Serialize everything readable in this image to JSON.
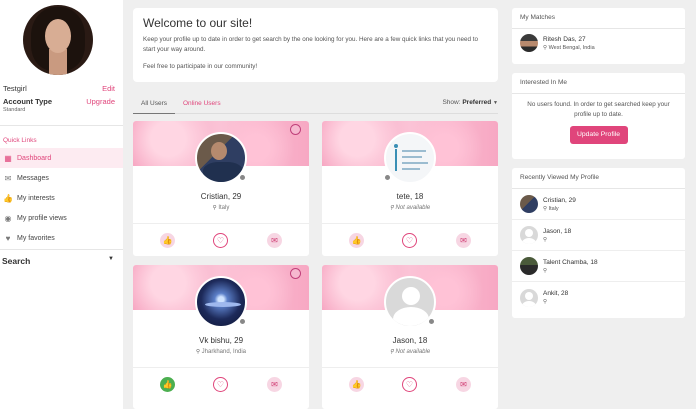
{
  "user": {
    "name": "Testgirl",
    "edit_label": "Edit",
    "account_type_label": "Account Type",
    "upgrade_label": "Upgrade",
    "account_level": "Standard"
  },
  "quick_links": {
    "title": "Quick Links",
    "items": [
      {
        "label": "Dashboard",
        "icon": "dashboard-icon",
        "active": true
      },
      {
        "label": "Messages",
        "icon": "envelope-icon"
      },
      {
        "label": "My interests",
        "icon": "thumbs-up-icon"
      },
      {
        "label": "My profile views",
        "icon": "eye-icon"
      },
      {
        "label": "My favorites",
        "icon": "heart-icon"
      }
    ]
  },
  "search": {
    "label": "Search"
  },
  "welcome": {
    "title": "Welcome to our site!",
    "text1": "Keep your profile up to date in order to get search by the one looking for you. Here are a few quick links that you need to start your way around.",
    "text2": "Feel free to participate in our community!"
  },
  "tabs": {
    "all": "All Users",
    "online": "Online Users",
    "show_label": "Show:",
    "show_value": "Preferred"
  },
  "cards": [
    {
      "name": "Cristian, 29",
      "location": "Italy"
    },
    {
      "name": "tete, 18",
      "location": "Not available"
    },
    {
      "name": "Vk bishu, 29",
      "location": "Jharkhand, India"
    },
    {
      "name": "Jason, 18",
      "location": "Not available"
    }
  ],
  "my_matches": {
    "title": "My Matches",
    "items": [
      {
        "name": "Ritesh Das, 27",
        "location": "West Bengal, India"
      }
    ]
  },
  "interested": {
    "title": "Interested In Me",
    "empty_text": "No users found. In order to get searched keep your profile up to date.",
    "button": "Update Profile"
  },
  "recently_viewed": {
    "title": "Recently Viewed My Profile",
    "items": [
      {
        "name": "Cristian, 29",
        "location": "Italy"
      },
      {
        "name": "Jason, 18",
        "location": ""
      },
      {
        "name": "Talent Chamba, 18",
        "location": ""
      },
      {
        "name": "Ankit, 28",
        "location": ""
      }
    ]
  },
  "colors": {
    "accent": "#e0457b",
    "like_active": "#4caf50"
  }
}
